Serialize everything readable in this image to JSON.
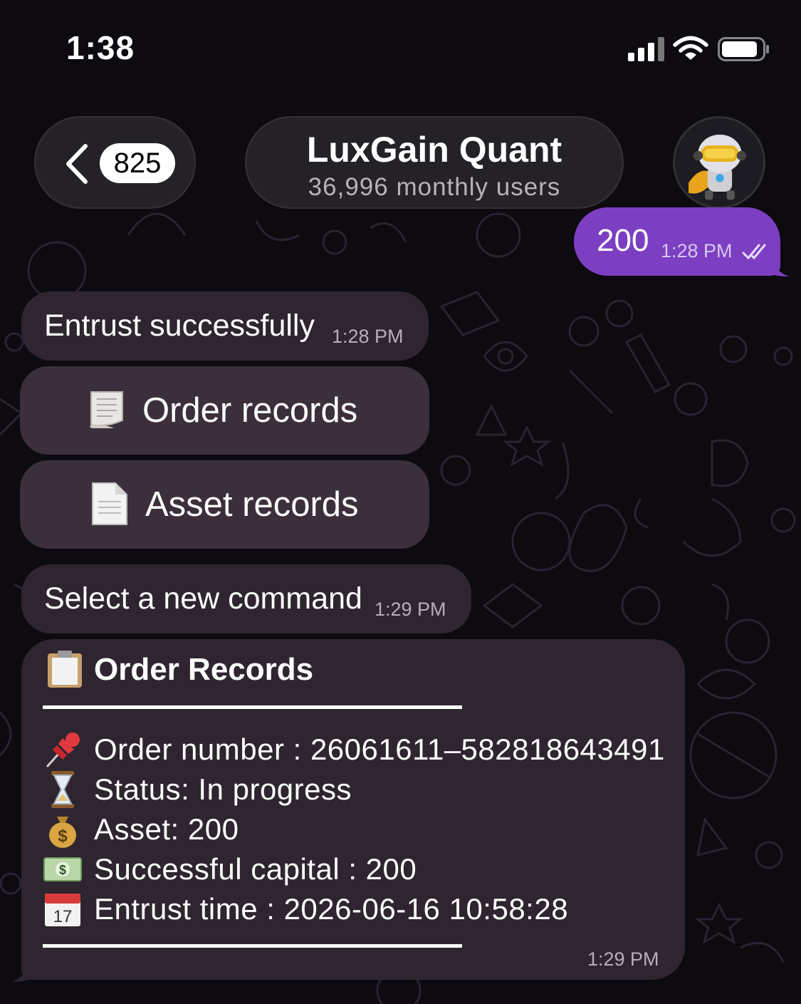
{
  "status_bar": {
    "time": "1:38"
  },
  "header": {
    "unread_count": "825",
    "chat_title": "LuxGain Quant",
    "chat_subtitle": "36,996 monthly users"
  },
  "messages": {
    "outgoing": {
      "text": "200",
      "time": "1:28 PM"
    },
    "entrust": {
      "text": "Entrust successfully",
      "time": "1:28 PM"
    },
    "keyboard": {
      "order_records_label": "Order records",
      "asset_records_label": "Asset records"
    },
    "select_command": {
      "text": "Select a new command",
      "time": "1:29 PM"
    },
    "order_card": {
      "title": "Order Records",
      "rows": [
        {
          "icon": "pushpin-icon",
          "text": "Order number : 26061611–582818643491"
        },
        {
          "icon": "hourglass-icon",
          "text": "Status: In progress"
        },
        {
          "icon": "money-bag-icon",
          "text": "Asset: 200"
        },
        {
          "icon": "dollar-banknote-icon",
          "text": "Successful capital : 200"
        },
        {
          "icon": "calendar-icon",
          "text": "Entrust time : 2026-06-16 10:58:28"
        }
      ],
      "time": "1:29 PM"
    }
  },
  "colors": {
    "outgoing_bubble": "#7c3fc2",
    "incoming_bubble": "#2f2530",
    "keyboard_button": "#3a2f3b",
    "background": "#0d0a10"
  }
}
